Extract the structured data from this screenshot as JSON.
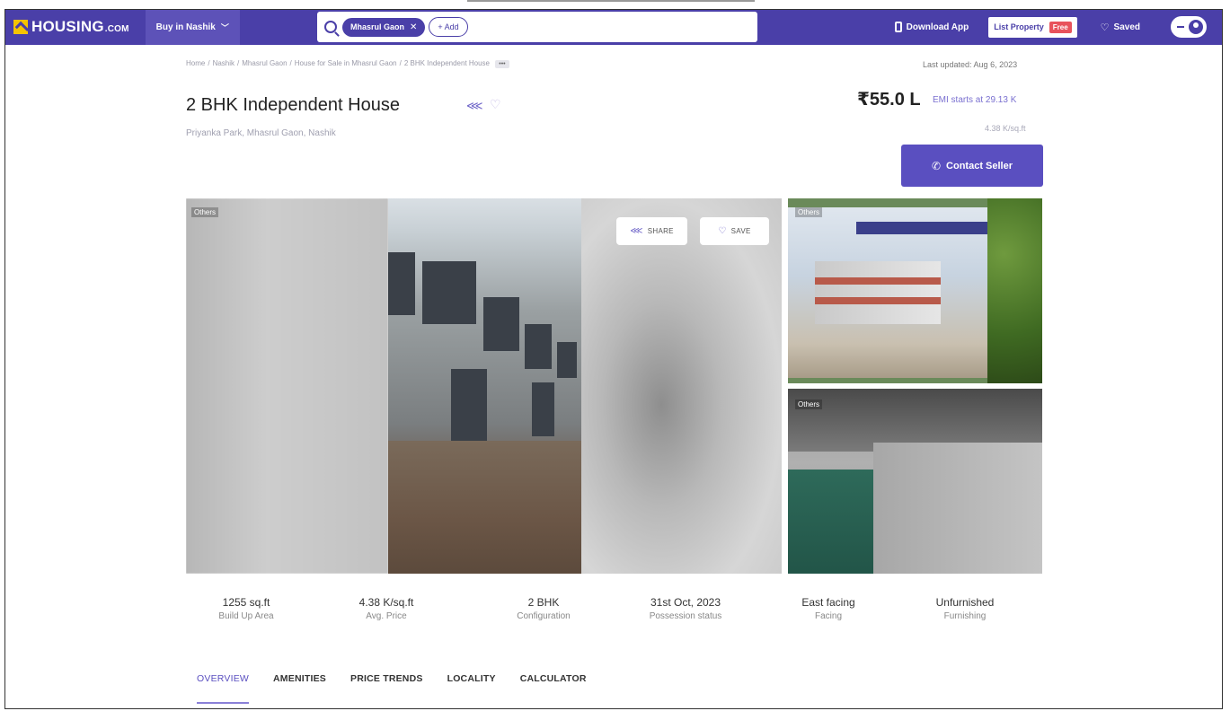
{
  "header": {
    "logo": "HOUSING",
    "logo_suffix": ".COM",
    "city_selector": "Buy in Nashik",
    "search_chip": "Mhasrul Gaon",
    "add_chip": "+ Add",
    "download_app": "Download App",
    "list_property": "List Property",
    "free_badge": "Free",
    "saved": "Saved"
  },
  "breadcrumb": {
    "items": [
      "Home",
      "Nashik",
      "Mhasrul Gaon",
      "House for Sale in Mhasrul Gaon",
      "2 BHK Independent House"
    ],
    "more": "•••",
    "last_updated": "Last updated: Aug 6, 2023"
  },
  "listing": {
    "title": "2 BHK Independent House",
    "address": "Priyanka Park, Mhasrul Gaon, Nashik",
    "price": "₹55.0 L",
    "emi": "EMI starts at 29.13 K",
    "price_per_sqft": "4.38 K/sq.ft",
    "contact_button": "Contact Seller"
  },
  "gallery": {
    "tag_main": "Others",
    "tag_thumb1": "Others",
    "tag_thumb2": "Others",
    "share_button": "SHARE",
    "save_button": "SAVE"
  },
  "stats": [
    {
      "value": "1255 sq.ft",
      "label": "Build Up Area"
    },
    {
      "value": "4.38 K/sq.ft",
      "label": "Avg. Price"
    },
    {
      "value": "2 BHK",
      "label": "Configuration"
    },
    {
      "value": "31st Oct, 2023",
      "label": "Possession status"
    },
    {
      "value": "East facing",
      "label": "Facing"
    },
    {
      "value": "Unfurnished",
      "label": "Furnishing"
    }
  ],
  "tabs": [
    "OVERVIEW",
    "AMENITIES",
    "PRICE TRENDS",
    "LOCALITY",
    "CALCULATOR"
  ],
  "colors": {
    "brand": "#4a3fa8",
    "accent": "#5a4fc0",
    "free_badge": "#e8535c"
  }
}
